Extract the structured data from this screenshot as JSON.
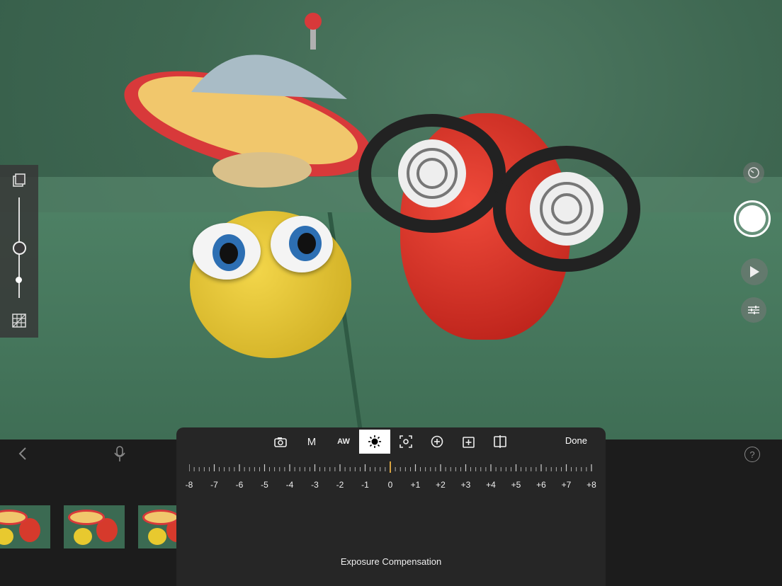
{
  "viewport": {
    "description_icon": "camera-preview"
  },
  "left_rail": {
    "icons": [
      "onion-skin-icon",
      "slider-knob",
      "slider-end",
      "grid-icon"
    ]
  },
  "right_controls": {
    "icons": [
      "timer-icon",
      "capture-button",
      "play-icon",
      "settings-sliders-icon"
    ]
  },
  "bottom_bar": {
    "icons": [
      "back-chevron-icon",
      "microphone-icon",
      "help-icon"
    ],
    "help_label": "?"
  },
  "panel": {
    "tools": [
      {
        "name": "camera-icon",
        "label": ""
      },
      {
        "name": "manual-mode",
        "label": "M"
      },
      {
        "name": "auto-white-balance",
        "label": "AW"
      },
      {
        "name": "exposure-icon",
        "label": ""
      },
      {
        "name": "focus-icon",
        "label": ""
      },
      {
        "name": "zoom-icon",
        "label": ""
      },
      {
        "name": "add-frame-icon",
        "label": ""
      },
      {
        "name": "mirror-icon",
        "label": ""
      }
    ],
    "done_label": "Done",
    "scale_labels": [
      "-8",
      "-7",
      "-6",
      "-5",
      "-4",
      "-3",
      "-2",
      "-1",
      "0",
      "+1",
      "+2",
      "+3",
      "+4",
      "+5",
      "+6",
      "+7",
      "+8"
    ],
    "current_value": 0,
    "caption": "Exposure Compensation"
  },
  "colors": {
    "accent": "#d9a441",
    "active_bg": "#ffffff"
  }
}
